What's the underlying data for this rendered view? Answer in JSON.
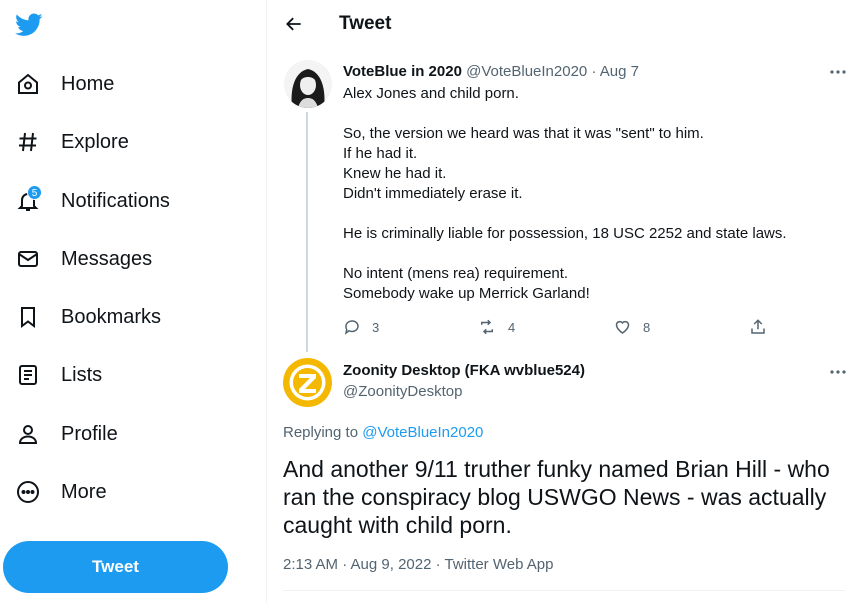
{
  "nav": {
    "items": [
      {
        "label": "Home",
        "icon": "home-icon"
      },
      {
        "label": "Explore",
        "icon": "hashtag-icon"
      },
      {
        "label": "Notifications",
        "icon": "bell-icon",
        "badge": "5"
      },
      {
        "label": "Messages",
        "icon": "envelope-icon"
      },
      {
        "label": "Bookmarks",
        "icon": "bookmark-icon"
      },
      {
        "label": "Lists",
        "icon": "list-icon"
      },
      {
        "label": "Profile",
        "icon": "person-icon"
      },
      {
        "label": "More",
        "icon": "more-circle-icon"
      }
    ],
    "tweet_button": "Tweet"
  },
  "header": {
    "title": "Tweet"
  },
  "parent_tweet": {
    "name": "VoteBlue in 2020",
    "handle": "@VoteBlueIn2020",
    "date": "Aug 7",
    "lines": [
      "Alex Jones and child porn.",
      "",
      "So, the version we heard was that it was \"sent\" to him.",
      "If he had it.",
      "Knew he had it.",
      "Didn't immediately erase it.",
      "",
      "He is criminally liable for possession, 18 USC 2252 and state laws.",
      "",
      "No intent (mens rea) requirement.",
      "Somebody wake up Merrick Garland!"
    ],
    "replies": "3",
    "retweets": "4",
    "likes": "8"
  },
  "focal_tweet": {
    "name": "Zoonity Desktop (FKA wvblue524)",
    "handle": "@ZoonityDesktop",
    "replying_prefix": "Replying to",
    "replying_to": "@VoteBlueIn2020",
    "text": "And another 9/11 truther funky named Brian Hill - who ran the conspiracy blog USWGO News - was actually caught with child porn.",
    "meta": "2:13 AM · Aug 9, 2022 · Twitter Web App"
  },
  "colors": {
    "accent": "#1d9bf0",
    "text": "#0f1419",
    "muted": "#536471",
    "avatar_zoonity": "#f5b800"
  }
}
